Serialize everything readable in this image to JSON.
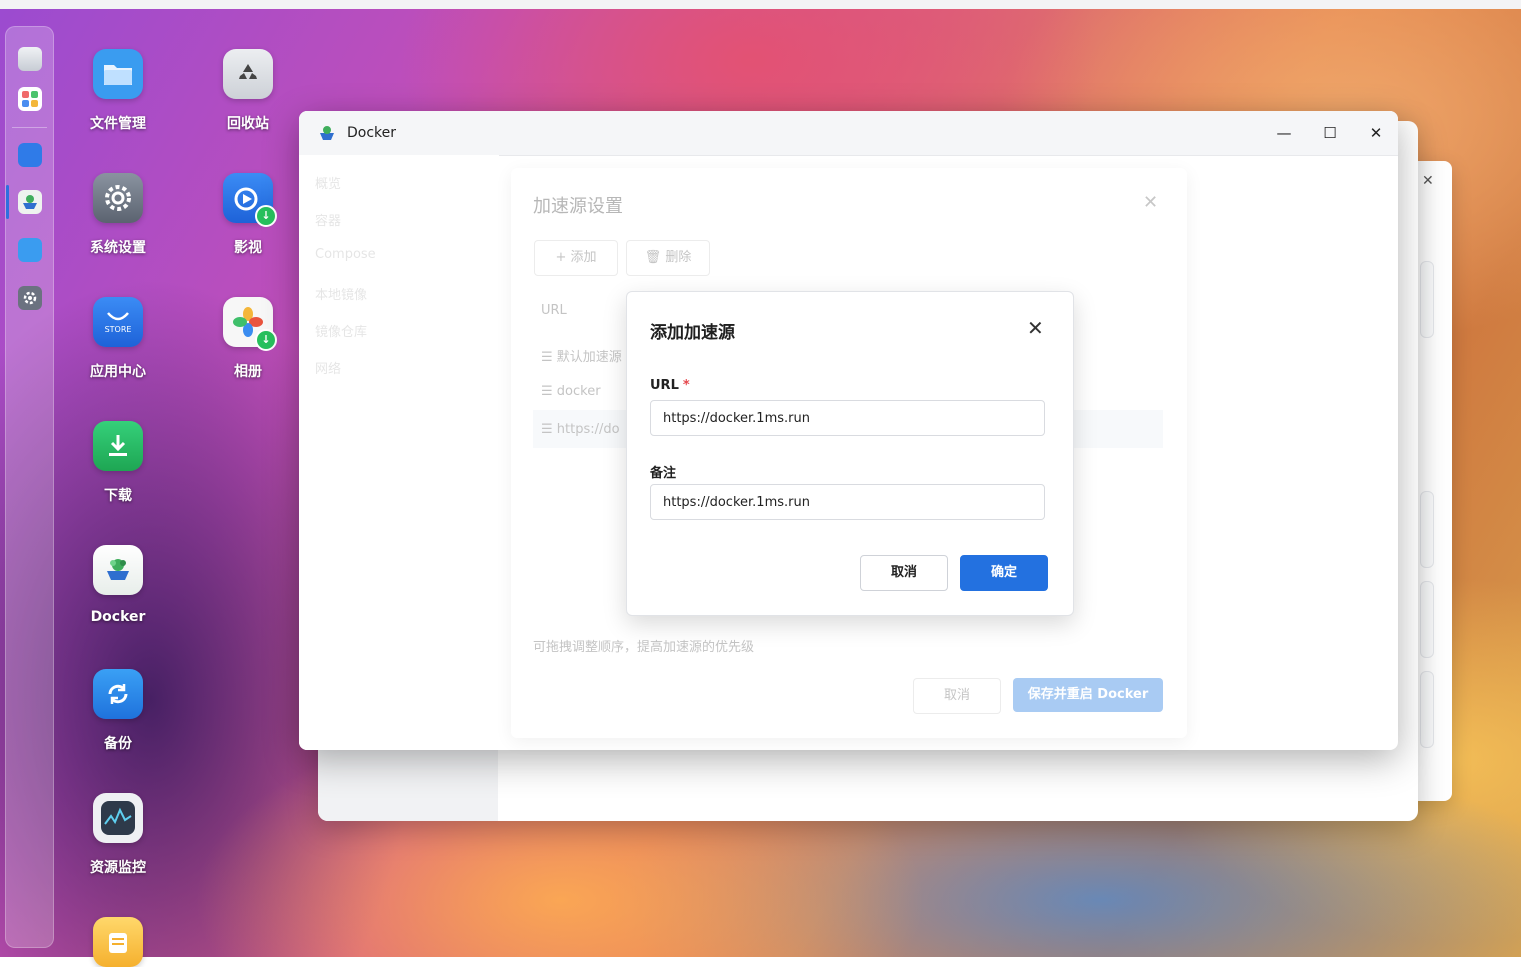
{
  "desktop": {
    "icons": [
      {
        "label": "文件管理",
        "icon": "folder-icon",
        "color": "#3a9cf0"
      },
      {
        "label": "回收站",
        "icon": "recycle-bin-icon",
        "color": "#d9dce2"
      },
      {
        "label": "系统设置",
        "icon": "gear-icon",
        "color": "#6b7280"
      },
      {
        "label": "影视",
        "icon": "video-icon",
        "color": "#2d7cf3"
      },
      {
        "label": "应用中心",
        "icon": "store-icon",
        "color": "#2f7be8",
        "icon_text": "STORE"
      },
      {
        "label": "相册",
        "icon": "photos-icon",
        "color": "#f5f5f5"
      },
      {
        "label": "下载",
        "icon": "download-icon",
        "color": "#24c064"
      },
      {
        "label": "Docker",
        "icon": "docker-icon",
        "color": "#f2f5f3"
      },
      {
        "label": "备份",
        "icon": "backup-icon",
        "color": "#2f8ff0"
      },
      {
        "label": "资源监控",
        "icon": "monitor-icon",
        "color": "#2e3a4a"
      }
    ]
  },
  "docker_window": {
    "title": "Docker",
    "sidebar": [
      "概览",
      "容器",
      "Compose",
      "本地镜像",
      "镜像仓库",
      "网络"
    ]
  },
  "speed_panel": {
    "title": "加速源设置",
    "add_label": "+ 添加",
    "delete_label": "删除",
    "column_url": "URL",
    "rows": [
      "默认加速源",
      "docker",
      "https://do"
    ],
    "hint": "可拖拽调整顺序，提高加速源的优先级",
    "cancel_label": "取消",
    "save_label": "保存并重启 Docker"
  },
  "dialog": {
    "title": "添加加速源",
    "url_label": "URL",
    "required_mark": "*",
    "url_value": "https://docker.1ms.run",
    "note_label": "备注",
    "note_value": "https://docker.1ms.run",
    "cancel_label": "取消",
    "ok_label": "确定"
  }
}
